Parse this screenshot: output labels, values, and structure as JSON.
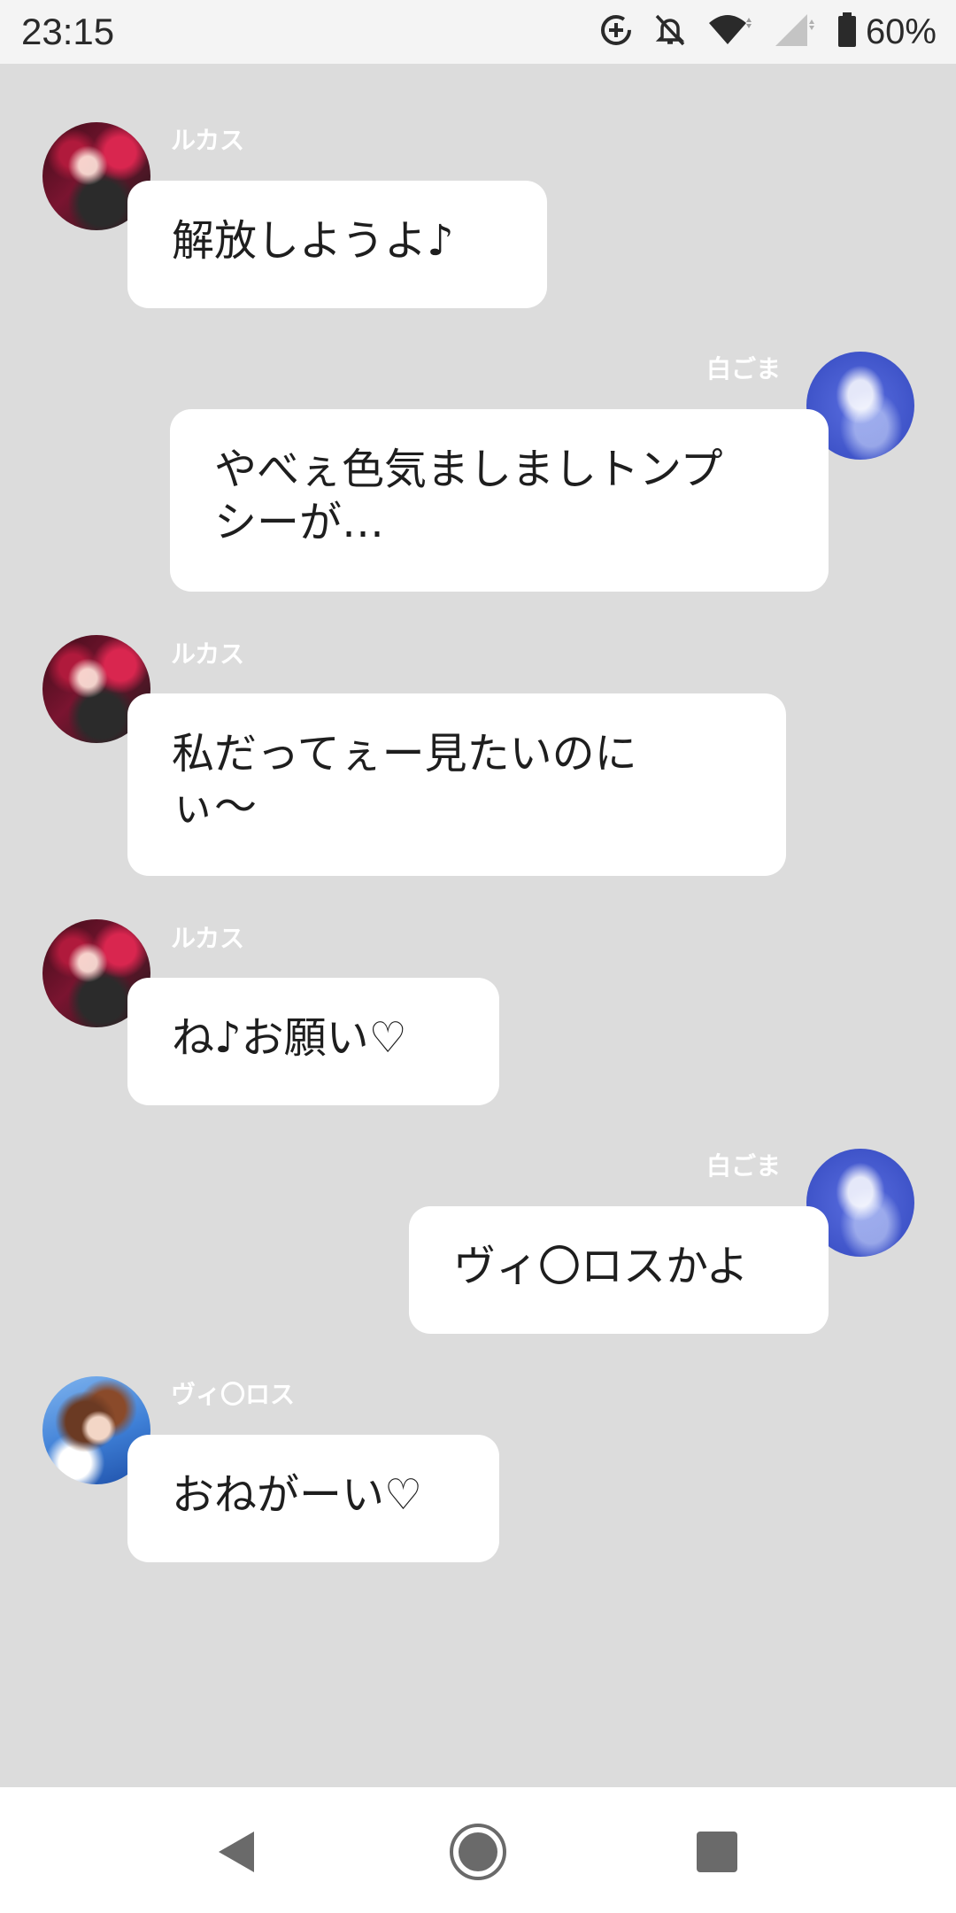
{
  "status_bar": {
    "time": "23:15",
    "battery_percent": "60%",
    "icons": [
      "data-saver-icon",
      "notifications-off-icon",
      "wifi-icon",
      "signal-icon",
      "battery-icon"
    ]
  },
  "messages": [
    {
      "sender": "ルカス",
      "side": "left",
      "avatar": "avatar-rukas",
      "text": "解放しようよ♪"
    },
    {
      "sender": "白ごま",
      "side": "right",
      "avatar": "avatar-shirogoma",
      "line1": "やべぇ色気ましましトンプ",
      "line2": "シーが…"
    },
    {
      "sender": "ルカス",
      "side": "left",
      "avatar": "avatar-rukas",
      "line1": "私だってぇー見たいのに",
      "line2": "ぃ〜"
    },
    {
      "sender": "ルカス",
      "side": "left",
      "avatar": "avatar-rukas",
      "text": "ね♪お願い♡"
    },
    {
      "sender": "白ごま",
      "side": "right",
      "avatar": "avatar-shirogoma",
      "text": "ヴィ〇ロスかよ"
    },
    {
      "sender": "ヴィ〇ロス",
      "side": "left",
      "avatar": "avatar-viros",
      "text": "おねがーい♡"
    }
  ],
  "nav_bar": {
    "buttons": [
      "back-icon",
      "home-icon",
      "recents-icon"
    ]
  },
  "colors": {
    "chat_background": "#dcdcdc",
    "bubble": "#ffffff",
    "status_bar": "#f4f4f4",
    "nav_bar": "#ffffff"
  }
}
